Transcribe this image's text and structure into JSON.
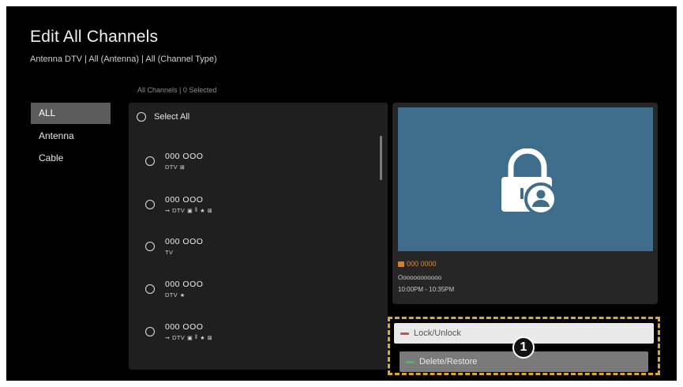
{
  "header": {
    "title": "Edit All Channels",
    "subtitle": "Antenna DTV | All (Antenna) | All (Channel Type)"
  },
  "categories": [
    {
      "label": "ALL",
      "selected": true
    },
    {
      "label": "Antenna",
      "selected": false
    },
    {
      "label": "Cable",
      "selected": false
    }
  ],
  "list": {
    "header": "All Channels | 0 Selected",
    "select_all_label": "Select All",
    "channels": [
      {
        "number": "000 OOO",
        "meta": "DTV",
        "icons": [
          "scramble-icon"
        ]
      },
      {
        "number": "000 OOO",
        "meta": "DTV",
        "icons": [
          "input-arrow-icon",
          "lock-icon",
          "skip-icon",
          "star-icon",
          "scramble-icon"
        ]
      },
      {
        "number": "000 OOO",
        "meta": "TV",
        "icons": []
      },
      {
        "number": "000 OOO",
        "meta": "DTV",
        "icons": [
          "star-icon"
        ]
      },
      {
        "number": "000 OOO",
        "meta": "DTV",
        "icons": [
          "input-arrow-icon",
          "lock-icon",
          "skip-icon",
          "star-icon",
          "scramble-icon"
        ]
      }
    ]
  },
  "preview": {
    "channel_number": "000 0000",
    "program_title": "Oooooooooooo",
    "program_time": "10:00PM - 10:35PM",
    "preview_bg": "#3f6e8c",
    "accent": "#d97d22"
  },
  "actions": {
    "lock_label": "Lock/Unlock",
    "lock_key_color": "#e04848",
    "delete_label": "Delete/Restore",
    "delete_key_color": "#38c25a",
    "callout_number": "1",
    "highlight_color": "#e0a92d"
  }
}
